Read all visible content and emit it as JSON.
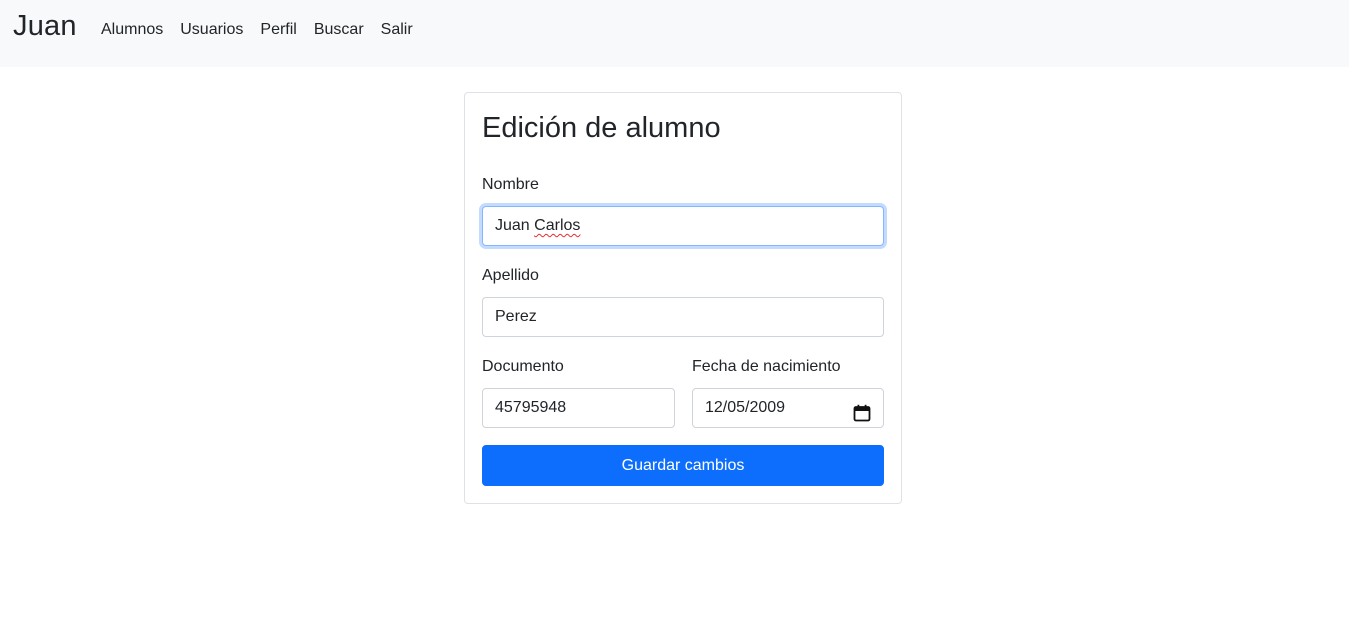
{
  "navbar": {
    "brand": "Juan",
    "links": [
      "Alumnos",
      "Usuarios",
      "Perfil",
      "Buscar",
      "Salir"
    ]
  },
  "form": {
    "title": "Edición de alumno",
    "nombre": {
      "label": "Nombre",
      "value_first": "Juan",
      "value_second": "Carlos"
    },
    "apellido": {
      "label": "Apellido",
      "value": "Perez"
    },
    "documento": {
      "label": "Documento",
      "value": "45795948"
    },
    "fecha": {
      "label": "Fecha de nacimiento",
      "value": "12/05/2009",
      "icon": "calendar-icon"
    },
    "submit_label": "Guardar cambios"
  },
  "colors": {
    "primary": "#0d6efd",
    "navbar_bg": "#f8f9fa",
    "focus_border": "#86b7fe"
  }
}
